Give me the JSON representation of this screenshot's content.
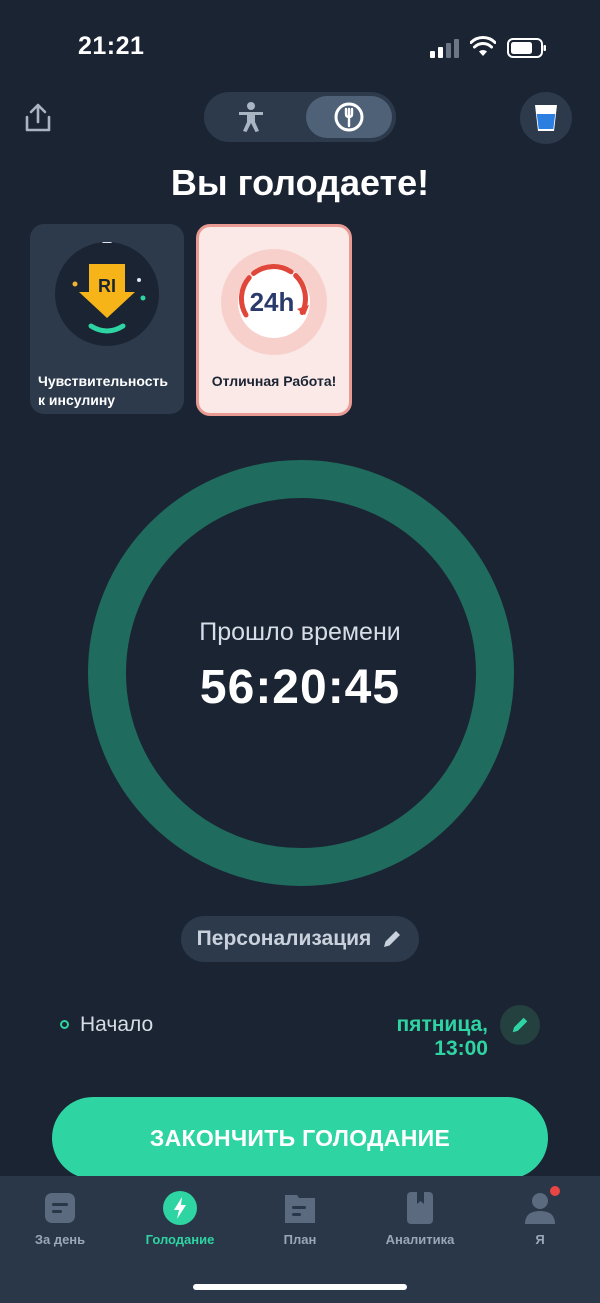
{
  "status_bar": {
    "time": "21:21"
  },
  "header": {
    "share_icon": "share-icon",
    "mode_activity_icon": "person-icon",
    "mode_fasting_icon": "plate-fork-icon",
    "water_icon": "water-glass-icon"
  },
  "title": "Вы голодаете!",
  "cards": [
    {
      "label": "Чувствительность к инсулину",
      "badge": "RI",
      "icon": "insulin-arrow-icon"
    },
    {
      "label": "Отличная Работа!",
      "badge": "24h",
      "icon": "24h-clock-icon"
    }
  ],
  "timer": {
    "label": "Прошло времени",
    "value": "56:20:45"
  },
  "personalization": {
    "label": "Персонализация",
    "icon": "pencil-icon"
  },
  "start": {
    "label": "Начало",
    "value": "пятница, 13:00",
    "edit_icon": "pencil-icon"
  },
  "end_button": {
    "label": "ЗАКОНЧИТЬ ГОЛОДАНИЕ"
  },
  "tabs": [
    {
      "label": "За день",
      "icon": "day-note-icon",
      "active": false
    },
    {
      "label": "Голодание",
      "icon": "lightning-icon",
      "active": true
    },
    {
      "label": "План",
      "icon": "plan-folder-icon",
      "active": false
    },
    {
      "label": "Аналитика",
      "icon": "book-icon",
      "active": false
    },
    {
      "label": "Я",
      "icon": "profile-icon",
      "active": false
    }
  ],
  "colors": {
    "background": "#1b2433",
    "accent": "#2fd4a3",
    "ring": "#1f6b5e",
    "surface": "#2c3a4c",
    "notification": "#e84545"
  }
}
